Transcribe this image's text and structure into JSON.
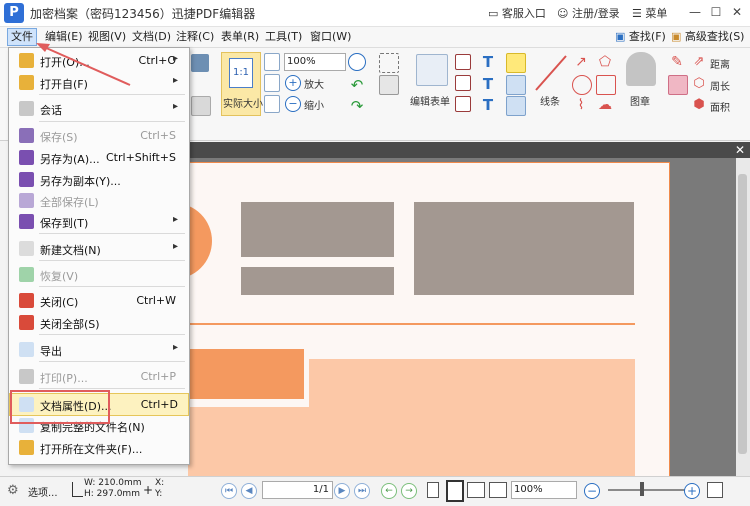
{
  "window": {
    "title": "加密档案（密码123456）迅捷PDF编辑器",
    "logo": "P",
    "service_label": "客服入口",
    "login_label": "注册/登录",
    "menu_label": "菜单",
    "minimize_symbol": "—",
    "maximize_symbol": "☐",
    "close_symbol": "✕"
  },
  "menubar": {
    "items": [
      "文件",
      "编辑(E)",
      "视图(V)",
      "文档(D)",
      "注释(C)",
      "表单(R)",
      "工具(T)",
      "窗口(W)"
    ],
    "find_label": "查找(F)",
    "advanced_find_label": "高级查找(S)"
  },
  "ribbon": {
    "actual_size_icon": "1:1",
    "actual_size_label": "实际大小",
    "zoom_value": "100%",
    "zoom_in_label": "放大",
    "zoom_out_label": "缩小",
    "edit_form_label": "编辑表单",
    "line_label": "线条",
    "stamp_label": "图章",
    "distance_label": "距离",
    "perimeter_label": "周长",
    "area_label": "面积"
  },
  "file_menu": {
    "items": [
      {
        "label": "打开(O)...",
        "shortcut": "Ctrl+O",
        "arrow": "▸",
        "disabled": false,
        "icon": "open-folder-icon"
      },
      {
        "label": "打开自(F)",
        "shortcut": "",
        "arrow": "▸",
        "disabled": false,
        "icon": "open-from-icon"
      },
      {
        "label": "会话",
        "shortcut": "",
        "arrow": "▸",
        "disabled": false,
        "icon": "session-icon"
      },
      {
        "label": "保存(S)",
        "shortcut": "Ctrl+S",
        "arrow": "",
        "disabled": true,
        "icon": "save-icon"
      },
      {
        "label": "另存为(A)...",
        "shortcut": "Ctrl+Shift+S",
        "arrow": "",
        "disabled": false,
        "icon": "save-as-icon"
      },
      {
        "label": "另存为副本(Y)...",
        "shortcut": "",
        "arrow": "",
        "disabled": false,
        "icon": "save-copy-icon"
      },
      {
        "label": "全部保存(L)",
        "shortcut": "",
        "arrow": "",
        "disabled": true,
        "icon": "save-all-icon"
      },
      {
        "label": "保存到(T)",
        "shortcut": "",
        "arrow": "▸",
        "disabled": false,
        "icon": "save-to-icon"
      },
      {
        "label": "新建文档(N)",
        "shortcut": "",
        "arrow": "▸",
        "disabled": false,
        "icon": "new-doc-icon"
      },
      {
        "label": "恢复(V)",
        "shortcut": "",
        "arrow": "",
        "disabled": true,
        "icon": "restore-icon"
      },
      {
        "label": "关闭(C)",
        "shortcut": "Ctrl+W",
        "arrow": "",
        "disabled": false,
        "icon": "close-doc-icon"
      },
      {
        "label": "关闭全部(S)",
        "shortcut": "",
        "arrow": "",
        "disabled": false,
        "icon": "close-all-icon"
      },
      {
        "label": "导出",
        "shortcut": "",
        "arrow": "▸",
        "disabled": false,
        "icon": "export-icon"
      },
      {
        "label": "打印(P)...",
        "shortcut": "Ctrl+P",
        "arrow": "",
        "disabled": true,
        "icon": "print-icon"
      },
      {
        "label": "文档属性(D)...",
        "shortcut": "Ctrl+D",
        "arrow": "",
        "disabled": false,
        "icon": "doc-properties-icon"
      },
      {
        "label": "复制完整的文件名(N)",
        "shortcut": "",
        "arrow": "",
        "disabled": false,
        "icon": "copy-filename-icon"
      },
      {
        "label": "打开所在文件夹(F)...",
        "shortcut": "",
        "arrow": "",
        "disabled": false,
        "icon": "open-containing-folder-icon"
      }
    ]
  },
  "status": {
    "options_label": "选项...",
    "width_label": "W: 210.0mm",
    "height_label": "H: 297.0mm",
    "x_label": "X:",
    "y_label": "Y:",
    "page_value": "1/1",
    "zoom_value": "100%",
    "zoom_minus": "−",
    "zoom_plus": "+"
  },
  "colors": {
    "accent": "#2f6fd6",
    "highlight": "#fdf2c0",
    "callout": "#e05c5c",
    "page_orange": "#f4995f",
    "page_gray": "#a39891",
    "page_peach": "#fcc8a7"
  }
}
